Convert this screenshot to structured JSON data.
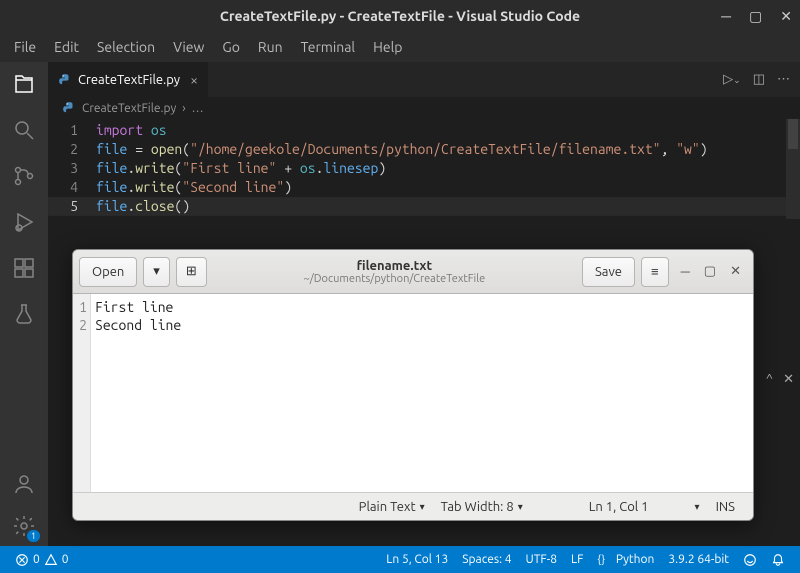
{
  "window": {
    "title": "CreateTextFile.py - CreateTextFile - Visual Studio Code"
  },
  "menu": [
    "File",
    "Edit",
    "Selection",
    "View",
    "Go",
    "Run",
    "Terminal",
    "Help"
  ],
  "tab": {
    "name": "CreateTextFile.py"
  },
  "breadcrumb": {
    "file": "CreateTextFile.py",
    "more": "…"
  },
  "code": {
    "lines": [
      {
        "n": 1,
        "kw": "import",
        "mod": "os"
      },
      {
        "n": 2,
        "var1": "file",
        "op1": " = ",
        "fn": "open",
        "p1": "(",
        "str": "\"/home/geekole/Documents/python/CreateTextFile/filename.txt\"",
        "comma": ", ",
        "str2": "\"w\"",
        "p2": ")"
      },
      {
        "n": 3,
        "var1": "file",
        "dot": ".",
        "fn": "write",
        "p1": "(",
        "str": "\"First line\"",
        "op": " + ",
        "mod": "os",
        "dot2": ".",
        "var2": "linesep",
        "p2": ")"
      },
      {
        "n": 4,
        "var1": "file",
        "dot": ".",
        "fn": "write",
        "p1": "(",
        "str": "\"Second line\"",
        "p2": ")"
      },
      {
        "n": 5,
        "var1": "file",
        "dot": ".",
        "fn": "close",
        "p1": "(",
        "p2": ")"
      }
    ]
  },
  "gedit": {
    "open": "Open",
    "save": "Save",
    "title": "filename.txt",
    "subtitle": "~/Documents/python/CreateTextFile",
    "lines": [
      "First line",
      "Second line"
    ],
    "status": {
      "lang": "Plain Text",
      "tab": "Tab Width: 8",
      "pos": "Ln 1, Col 1",
      "ins": "INS"
    }
  },
  "status": {
    "errors": "0",
    "warnings": "0",
    "pos": "Ln 5, Col 13",
    "spaces": "Spaces: 4",
    "enc": "UTF-8",
    "eol": "LF",
    "lang": "Python",
    "py": "3.9.2 64-bit"
  },
  "activity_badge": "1"
}
